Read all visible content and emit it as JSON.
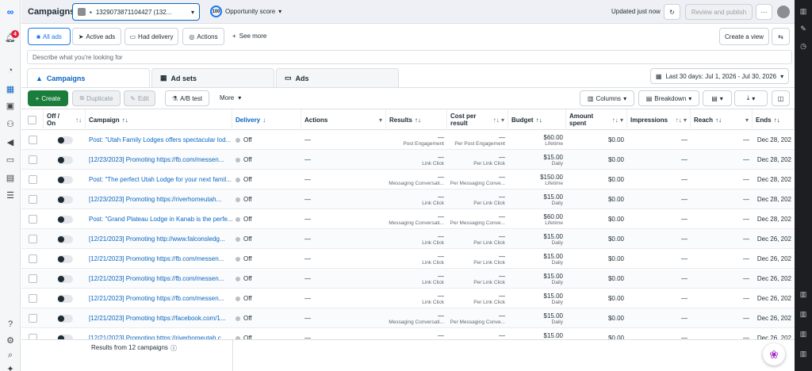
{
  "topbar": {
    "title": "Campaigns",
    "account": "1329073871104427 (132...",
    "opportunity_score_value": "100",
    "opportunity_score_label": "Opportunity score",
    "updated": "Updated just now",
    "review_publish": "Review and publish"
  },
  "leftnav": {
    "badge_count": "4"
  },
  "filters": {
    "all_ads": "All ads",
    "active_ads": "Active ads",
    "had_delivery": "Had delivery",
    "actions": "Actions",
    "see_more": "See more",
    "create_view": "Create a view"
  },
  "search": {
    "placeholder": "Describe what you're looking for"
  },
  "tabs": {
    "campaigns": "Campaigns",
    "adsets": "Ad sets",
    "ads": "Ads"
  },
  "daterange": "Last 30 days: Jul 1, 2026 - Jul 30, 2026",
  "toolbar": {
    "create": "Create",
    "duplicate": "Duplicate",
    "edit": "Edit",
    "ab_test": "A/B test",
    "more": "More",
    "columns": "Columns",
    "breakdown": "Breakdown"
  },
  "headers": {
    "offon": "Off / On",
    "campaign": "Campaign",
    "delivery": "Delivery",
    "actions": "Actions",
    "results": "Results",
    "cost_per_result": "Cost per result",
    "budget": "Budget",
    "amount_spent": "Amount spent",
    "impressions": "Impressions",
    "reach": "Reach",
    "ends": "Ends"
  },
  "rows": [
    {
      "campaign": "Post: \"Utah Family Lodges offers spectacular lod...",
      "delivery": "Off",
      "actions": "—",
      "results": "—",
      "results_sub": "Post Engagement",
      "cpr": "—",
      "cpr_sub": "Per Post Engagement",
      "budget": "$60.00",
      "budget_sub": "Lifetime",
      "spent": "$0.00",
      "impressions": "—",
      "reach": "—",
      "ends": "Dec 28, 202"
    },
    {
      "campaign": "[12/23/2023] Promoting https://fb.com/messen...",
      "delivery": "Off",
      "actions": "—",
      "results": "—",
      "results_sub": "Link Click",
      "cpr": "—",
      "cpr_sub": "Per Link Click",
      "budget": "$15.00",
      "budget_sub": "Daily",
      "spent": "$0.00",
      "impressions": "—",
      "reach": "—",
      "ends": "Dec 28, 202"
    },
    {
      "campaign": "Post: \"The perfect Utah Lodge for your next famil...",
      "delivery": "Off",
      "actions": "—",
      "results": "—",
      "results_sub": "Messaging Conversati...",
      "cpr": "—",
      "cpr_sub": "Per Messaging Conve...",
      "budget": "$150.00",
      "budget_sub": "Lifetime",
      "spent": "$0.00",
      "impressions": "—",
      "reach": "—",
      "ends": "Dec 28, 202"
    },
    {
      "campaign": "[12/23/2023] Promoting https://riverhomeutah...",
      "delivery": "Off",
      "actions": "—",
      "results": "—",
      "results_sub": "Link Click",
      "cpr": "—",
      "cpr_sub": "Per Link Click",
      "budget": "$15.00",
      "budget_sub": "Daily",
      "spent": "$0.00",
      "impressions": "—",
      "reach": "—",
      "ends": "Dec 28, 202"
    },
    {
      "campaign": "Post: \"Grand Plateau Lodge in Kanab is the perfe...",
      "delivery": "Off",
      "actions": "—",
      "results": "—",
      "results_sub": "Messaging Conversati...",
      "cpr": "—",
      "cpr_sub": "Per Messaging Conve...",
      "budget": "$60.00",
      "budget_sub": "Lifetime",
      "spent": "$0.00",
      "impressions": "—",
      "reach": "—",
      "ends": "Dec 28, 202"
    },
    {
      "campaign": "[12/21/2023] Promoting http://www.falconsledg...",
      "delivery": "Off",
      "actions": "—",
      "results": "—",
      "results_sub": "Link Click",
      "cpr": "—",
      "cpr_sub": "Per Link Click",
      "budget": "$15.00",
      "budget_sub": "Daily",
      "spent": "$0.00",
      "impressions": "—",
      "reach": "—",
      "ends": "Dec 26, 202"
    },
    {
      "campaign": "[12/21/2023] Promoting https://fb.com/messen...",
      "delivery": "Off",
      "actions": "—",
      "results": "—",
      "results_sub": "Link Click",
      "cpr": "—",
      "cpr_sub": "Per Link Click",
      "budget": "$15.00",
      "budget_sub": "Daily",
      "spent": "$0.00",
      "impressions": "—",
      "reach": "—",
      "ends": "Dec 26, 202"
    },
    {
      "campaign": "[12/21/2023] Promoting https://fb.com/messen...",
      "delivery": "Off",
      "actions": "—",
      "results": "—",
      "results_sub": "Link Click",
      "cpr": "—",
      "cpr_sub": "Per Link Click",
      "budget": "$15.00",
      "budget_sub": "Daily",
      "spent": "$0.00",
      "impressions": "—",
      "reach": "—",
      "ends": "Dec 26, 202"
    },
    {
      "campaign": "[12/21/2023] Promoting https://fb.com/messen...",
      "delivery": "Off",
      "actions": "—",
      "results": "—",
      "results_sub": "Link Click",
      "cpr": "—",
      "cpr_sub": "Per Link Click",
      "budget": "$15.00",
      "budget_sub": "Daily",
      "spent": "$0.00",
      "impressions": "—",
      "reach": "—",
      "ends": "Dec 26, 202"
    },
    {
      "campaign": "[12/21/2023] Promoting https://facebook.com/1...",
      "delivery": "Off",
      "actions": "—",
      "results": "—",
      "results_sub": "Messaging Conversati...",
      "cpr": "—",
      "cpr_sub": "Per Messaging Conve...",
      "budget": "$15.00",
      "budget_sub": "Daily",
      "spent": "$0.00",
      "impressions": "—",
      "reach": "—",
      "ends": "Dec 26, 202"
    },
    {
      "campaign": "[12/21/2023] Promoting https://riverhomeutah.c...",
      "delivery": "Off",
      "actions": "—",
      "results": "—",
      "results_sub": "Link Click",
      "cpr": "—",
      "cpr_sub": "Per Link Click",
      "budget": "$15.00",
      "budget_sub": "Daily",
      "spent": "$0.00",
      "impressions": "—",
      "reach": "—",
      "ends": "Dec 26, 202"
    }
  ],
  "footer": {
    "results_count": "Results from 12 campaigns"
  }
}
